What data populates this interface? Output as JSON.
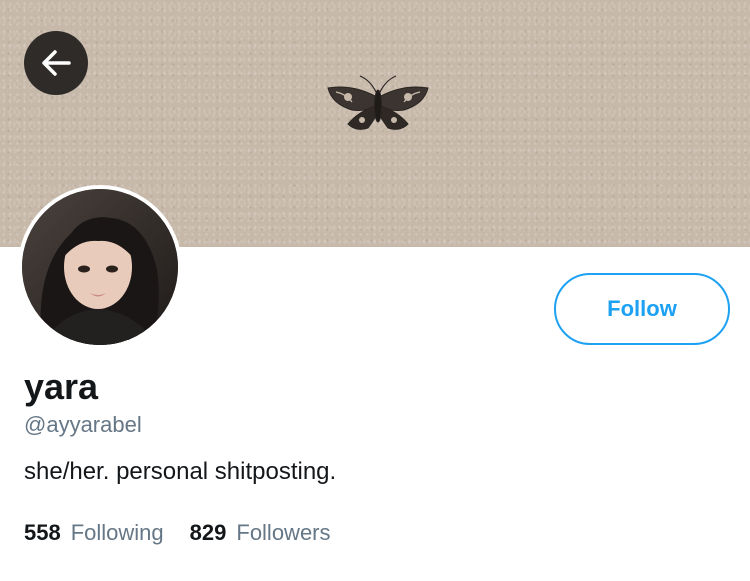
{
  "header": {
    "back_icon": "arrow-left-icon",
    "banner_motif": "moth-illustration"
  },
  "profile": {
    "avatar": "profile-photo",
    "display_name": "yara",
    "handle": "@ayyarabel",
    "bio": "she/her. personal shitposting.",
    "follow_label": "Follow"
  },
  "stats": {
    "following_count": "558",
    "following_label": "Following",
    "followers_count": "829",
    "followers_label": "Followers"
  },
  "colors": {
    "accent": "#1da1f2",
    "text_primary": "#14171a",
    "text_secondary": "#657786",
    "banner": "#c7b9aa"
  }
}
